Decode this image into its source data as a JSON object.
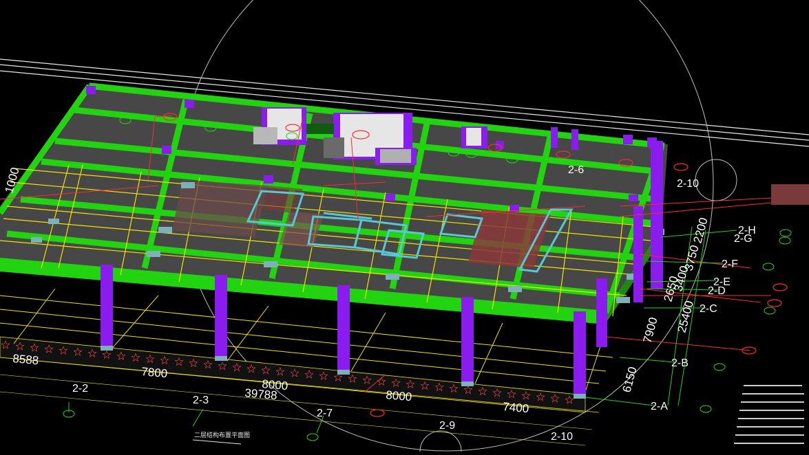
{
  "viewport": {
    "background": "#000000",
    "colors": {
      "slab": "#4a4a4a",
      "beam": "#22d30f",
      "column": "#8a1cf0",
      "axis": "#ffffff",
      "gridline": "#f2e300",
      "annotation": "#ff2a2a",
      "panel": "#59c7d4"
    }
  },
  "grid_axes": {
    "bottom": [
      "2-2",
      "2-3",
      "2-7",
      "2-9",
      "2-10"
    ],
    "right": [
      "2-H",
      "2-G",
      "2-F",
      "2-E",
      "2-D",
      "2-C",
      "2-B",
      "2-A"
    ],
    "top_right": [
      "2-6",
      "2-10"
    ]
  },
  "dimensions": {
    "bottom": [
      "8588",
      "7800",
      "8000",
      "39788",
      "8000",
      "7400"
    ],
    "right": [
      "6150",
      "7900",
      "25400",
      "2650",
      "3400",
      "3750",
      "2200"
    ],
    "left": "1000"
  },
  "drawing_title": "二层结构布置平面图"
}
